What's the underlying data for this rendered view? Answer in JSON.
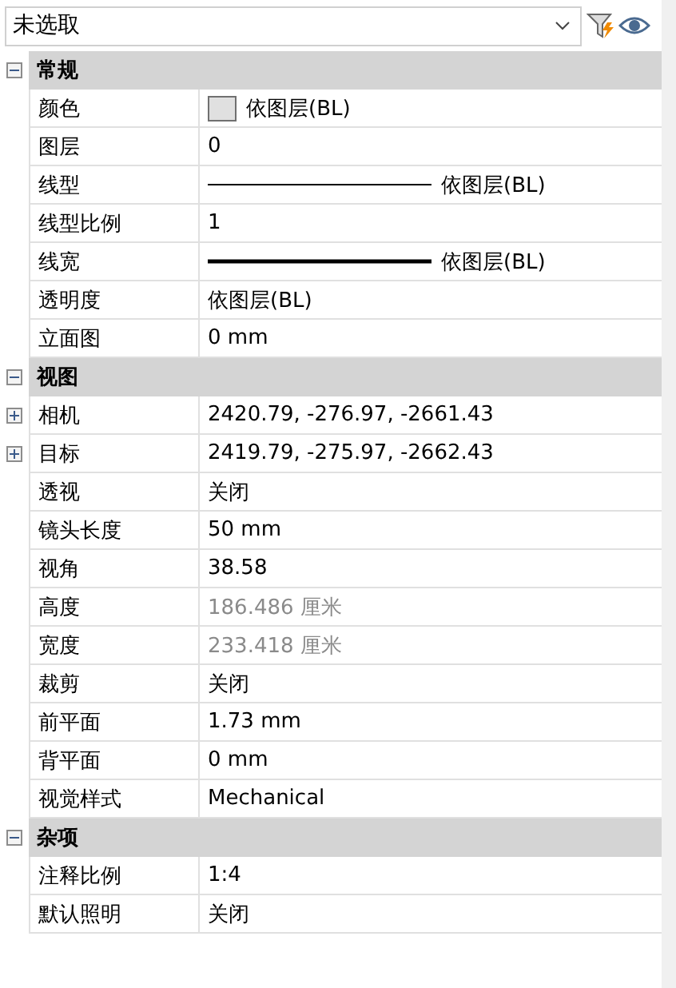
{
  "selector": {
    "value": "未选取"
  },
  "sections": [
    {
      "title": "常规",
      "expanded": true,
      "rows": [
        {
          "label": "颜色",
          "kind": "swatch",
          "value": "依图层(BL)",
          "disabled": false
        },
        {
          "label": "图层",
          "kind": "text",
          "value": "0",
          "disabled": false
        },
        {
          "label": "线型",
          "kind": "line",
          "value": "依图层(BL)",
          "disabled": false
        },
        {
          "label": "线型比例",
          "kind": "text",
          "value": "1",
          "disabled": false
        },
        {
          "label": "线宽",
          "kind": "thickline",
          "value": "依图层(BL)",
          "disabled": false
        },
        {
          "label": "透明度",
          "kind": "text",
          "value": "依图层(BL)",
          "disabled": false
        },
        {
          "label": "立面图",
          "kind": "text",
          "value": "0 mm",
          "disabled": false
        }
      ]
    },
    {
      "title": "视图",
      "expanded": true,
      "rows": [
        {
          "label": "相机",
          "kind": "text",
          "value": "2420.79, -276.97, -2661.43",
          "disabled": false,
          "expanded": false
        },
        {
          "label": "目标",
          "kind": "text",
          "value": "2419.79, -275.97, -2662.43",
          "disabled": false,
          "expanded": false
        },
        {
          "label": "透视",
          "kind": "text",
          "value": "关闭",
          "disabled": false
        },
        {
          "label": "镜头长度",
          "kind": "text",
          "value": "50 mm",
          "disabled": false
        },
        {
          "label": "视角",
          "kind": "text",
          "value": "38.58",
          "disabled": false
        },
        {
          "label": "高度",
          "kind": "text",
          "value": "186.486 厘米",
          "disabled": true
        },
        {
          "label": "宽度",
          "kind": "text",
          "value": "233.418 厘米",
          "disabled": true
        },
        {
          "label": "裁剪",
          "kind": "text",
          "value": "关闭",
          "disabled": false
        },
        {
          "label": "前平面",
          "kind": "text",
          "value": "1.73 mm",
          "disabled": false
        },
        {
          "label": "背平面",
          "kind": "text",
          "value": "0 mm",
          "disabled": false
        },
        {
          "label": "视觉样式",
          "kind": "text",
          "value": "Mechanical",
          "disabled": false
        }
      ]
    },
    {
      "title": "杂项",
      "expanded": true,
      "rows": [
        {
          "label": "注释比例",
          "kind": "text",
          "value": "1:4",
          "disabled": false
        },
        {
          "label": "默认照明",
          "kind": "text",
          "value": "关闭",
          "disabled": false
        }
      ]
    }
  ]
}
